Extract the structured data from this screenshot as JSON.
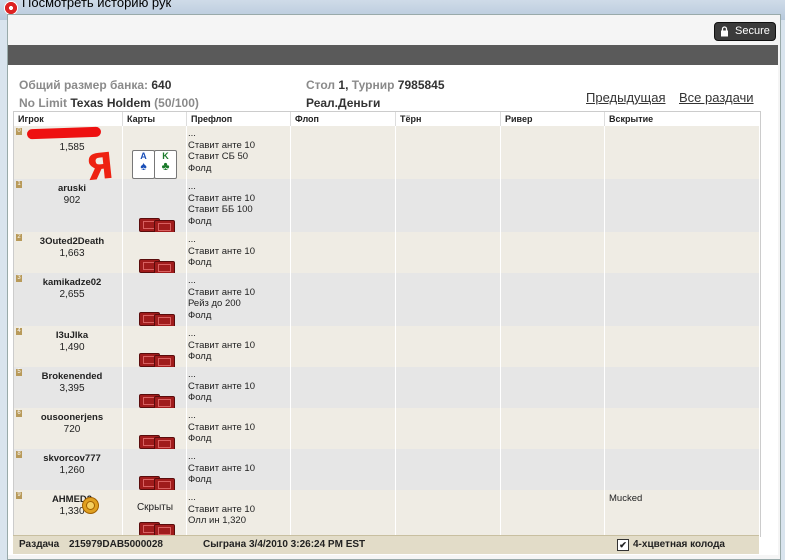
{
  "window": {
    "title": "Посмотреть историю рук"
  },
  "secure_badge": "Secure",
  "info": {
    "pot_label": "Общий размер банка:",
    "pot_value": "640",
    "table_label": "Стол",
    "table_value": "1",
    "tournament_label": "Турнир",
    "tournament_value": "7985845",
    "game": "No Limit",
    "game_name": "Texas Holdem",
    "blinds": "(50/100)",
    "money": "Реал.Деньги"
  },
  "nav": {
    "prev": "Предыдущая",
    "all": "Все раздачи"
  },
  "columns": [
    "Игрок",
    "Карты",
    "Префлоп",
    "Флоп",
    "Тёрн",
    "Ривер",
    "Вскрытие"
  ],
  "annotation": {
    "ya": "Я"
  },
  "players": [
    {
      "seat": "0",
      "name": "",
      "chips": "1,585",
      "cards": "A♠ K♣",
      "actions": [
        "...",
        "Ставит анте 10",
        "Ставит СБ 50",
        "Фолд"
      ],
      "showdown": ""
    },
    {
      "seat": "1",
      "name": "aruski",
      "chips": "902",
      "cards": "",
      "actions": [
        "...",
        "Ставит анте 10",
        "Ставит ББ 100",
        "Фолд"
      ],
      "showdown": ""
    },
    {
      "seat": "2",
      "name": "3Outed2Death",
      "chips": "1,663",
      "cards": "",
      "actions": [
        "...",
        "Ставит анте 10",
        "Фолд"
      ],
      "showdown": ""
    },
    {
      "seat": "3",
      "name": "kamikadze02",
      "chips": "2,655",
      "cards": "",
      "actions": [
        "...",
        "Ставит анте 10",
        "Рейз до 200",
        "Фолд"
      ],
      "showdown": ""
    },
    {
      "seat": "4",
      "name": "I3uJIka",
      "chips": "1,490",
      "cards": "",
      "actions": [
        "...",
        "Ставит анте 10",
        "Фолд"
      ],
      "showdown": ""
    },
    {
      "seat": "5",
      "name": "Brokenended",
      "chips": "3,395",
      "cards": "",
      "actions": [
        "...",
        "Ставит анте 10",
        "Фолд"
      ],
      "showdown": ""
    },
    {
      "seat": "6",
      "name": "ousoonerjens",
      "chips": "720",
      "cards": "",
      "actions": [
        "...",
        "Ставит анте 10",
        "Фолд"
      ],
      "showdown": ""
    },
    {
      "seat": "8",
      "name": "skvorcov777",
      "chips": "1,260",
      "cards": "",
      "actions": [
        "...",
        "Ставит анте 10",
        "Фолд"
      ],
      "showdown": ""
    },
    {
      "seat": "9",
      "name": "AHMED2",
      "chips": "1,330",
      "cards": "Скрыты",
      "actions": [
        "...",
        "Ставит анте 10",
        "Олл ин 1,320"
      ],
      "showdown": "Mucked"
    }
  ],
  "footer": {
    "hand_label": "Раздача",
    "hand_id": "215979DAB5000028",
    "played": "Сыграна 3/4/2010 3:26:24 PM EST",
    "four_color_label": "4-хцветная колода",
    "four_color_checked": "✔"
  }
}
